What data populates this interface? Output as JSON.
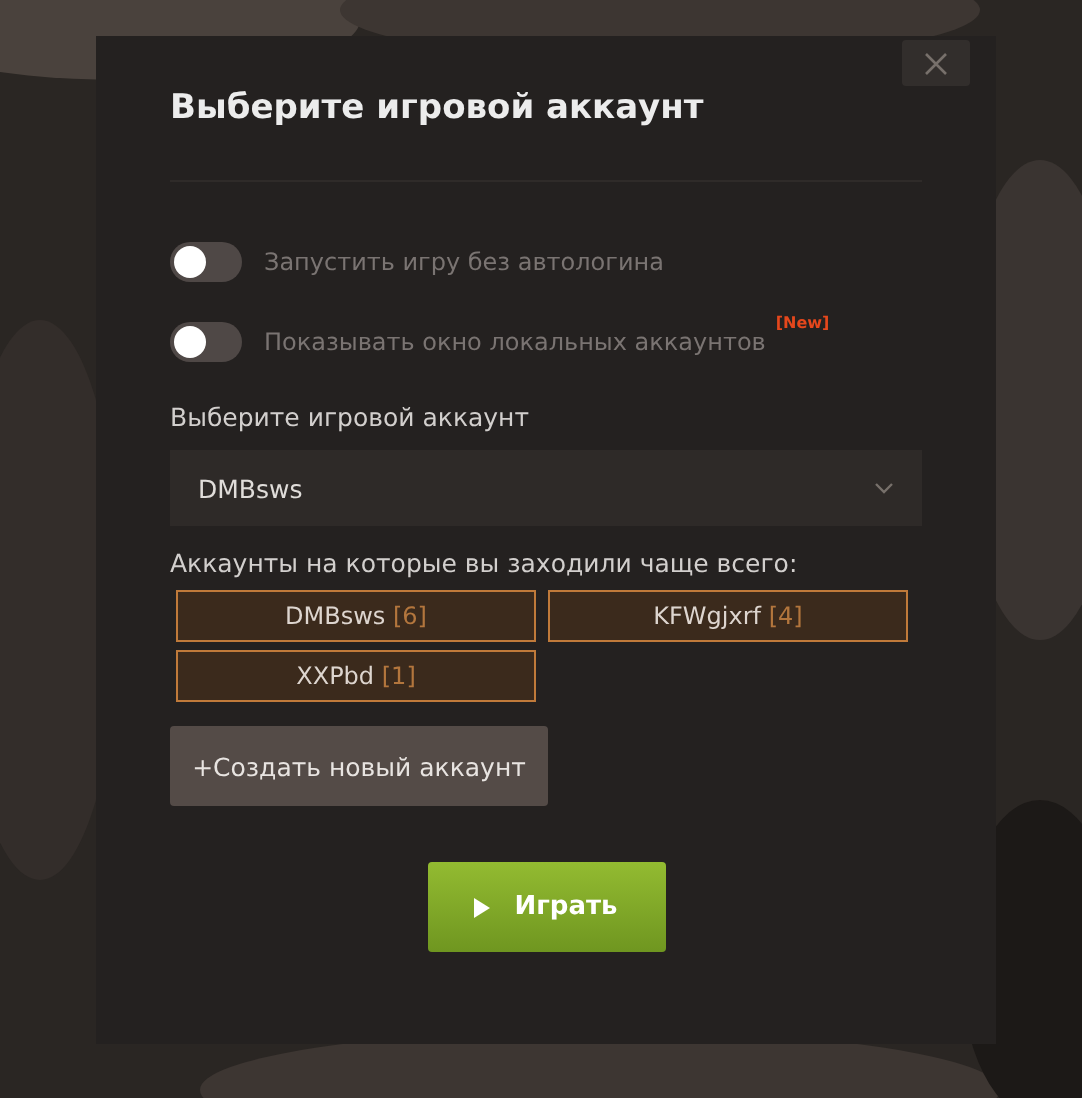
{
  "dialog": {
    "title": "Выберите игровой аккаунт"
  },
  "toggles": [
    {
      "label": "Запустить игру без автологина",
      "on": false
    },
    {
      "label": "Показывать окно локальных аккаунтов",
      "on": false,
      "badge": "[New]"
    }
  ],
  "account_select": {
    "label": "Выберите игровой аккаунт",
    "value": "DMBsws"
  },
  "frequent": {
    "label": "Аккаунты на которые вы заходили чаще всего:",
    "accounts": [
      {
        "name": "DMBsws",
        "count": "[6]"
      },
      {
        "name": "KFWgjxrf",
        "count": "[4]"
      },
      {
        "name": "XXPbd",
        "count": "[1]"
      }
    ]
  },
  "create_button": "+Создать новый аккаунт",
  "play_button": "Играть"
}
